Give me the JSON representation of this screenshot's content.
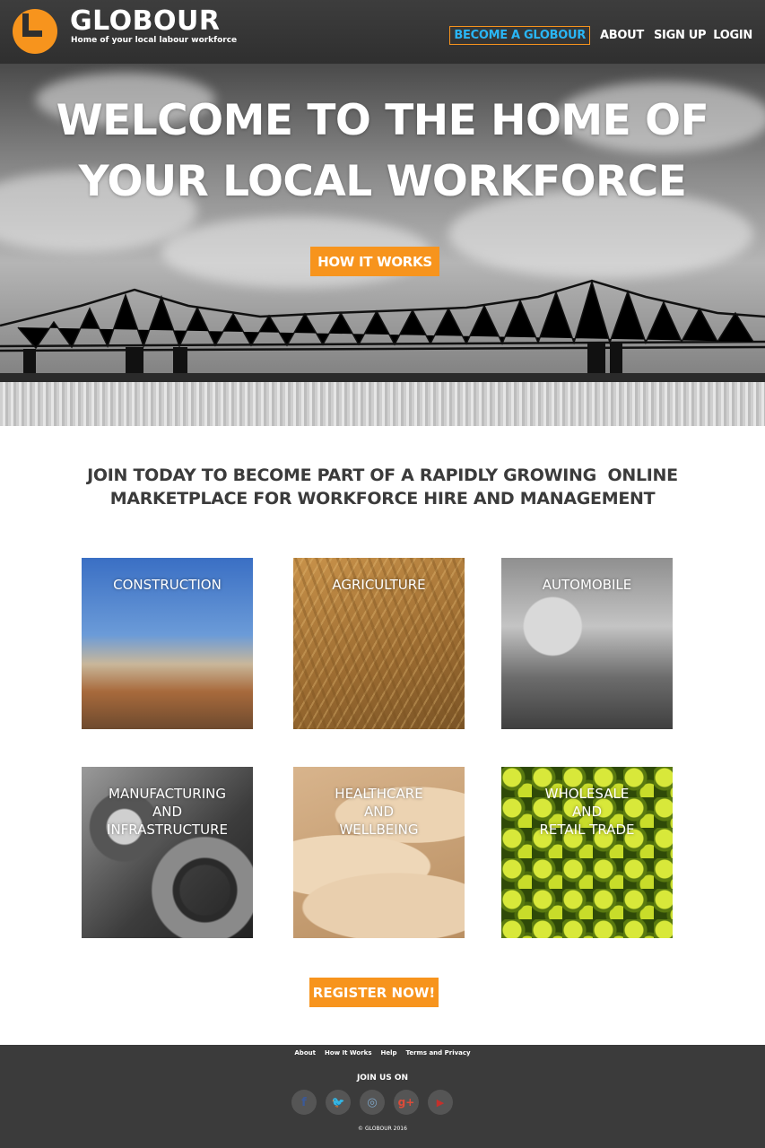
{
  "header": {
    "brand": "GLOBOUR",
    "tagline": "Home of your local labour workforce",
    "nav": {
      "become": "BECOME A GLOBOUR",
      "about": "ABOUT",
      "signup": "SIGN UP",
      "login": "LOGIN"
    }
  },
  "hero": {
    "title_line1": "WELCOME TO THE HOME OF",
    "title_line2": "YOUR LOCAL WORKFORCE",
    "cta": "HOW IT WORKS"
  },
  "intro": {
    "line1": "JOIN TODAY TO BECOME PART OF A RAPIDLY GROWING  ONLINE",
    "line2": "MARKETPLACE FOR WORKFORCE HIRE AND MANAGEMENT"
  },
  "categories": [
    {
      "lines": [
        "CONSTRUCTION"
      ]
    },
    {
      "lines": [
        "AGRICULTURE"
      ]
    },
    {
      "lines": [
        "AUTOMOBILE"
      ]
    },
    {
      "lines": [
        "MANUFACTURING",
        "AND",
        "INFRASTRUCTURE"
      ]
    },
    {
      "lines": [
        "HEALTHCARE",
        "AND",
        "WELLBEING"
      ]
    },
    {
      "lines": [
        "WHOLESALE",
        "AND",
        "RETAIL TRADE"
      ]
    }
  ],
  "register": "REGISTER NOW!",
  "footer": {
    "links": [
      "About",
      "How It Works",
      "Help",
      "Terms and Privacy"
    ],
    "join": "JOIN US ON",
    "social": [
      {
        "icon": "facebook-icon",
        "glyph": "f",
        "color": "#3b5998"
      },
      {
        "icon": "twitter-icon",
        "glyph": "🐦",
        "color": "#29b6f6"
      },
      {
        "icon": "instagram-icon",
        "glyph": "◎",
        "color": "#7fa6c8"
      },
      {
        "icon": "google-plus-icon",
        "glyph": "g+",
        "color": "#dd4b39"
      },
      {
        "icon": "youtube-icon",
        "glyph": "▶",
        "color": "#c4302b"
      }
    ],
    "copyright": "© GLOBOUR 2016"
  },
  "colors": {
    "accent": "#f7941d",
    "nav_highlight": "#29b6f6",
    "header_bg": "#333333",
    "footer_bg": "#3b3b3b",
    "text_dark": "#3b3b3b"
  }
}
